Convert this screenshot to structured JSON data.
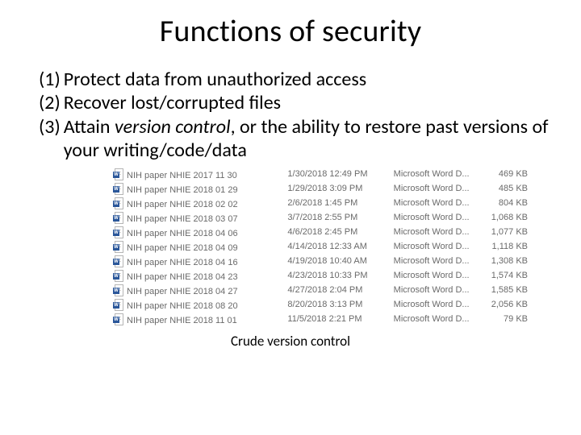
{
  "title": "Functions of security",
  "bullets": [
    {
      "num": "(1)",
      "text": "Protect data from unauthorized access"
    },
    {
      "num": "(2)",
      "text": "Recover lost/corrupted files"
    },
    {
      "num": "(3)",
      "text_pre": "Attain ",
      "vc": "version control",
      "text_post": ", or the ability to restore past versions of your writing/code/data"
    }
  ],
  "files": [
    {
      "name": "NIH paper NHIE 2017 11 30",
      "date": "1/30/2018 12:49 PM",
      "type": "Microsoft Word D...",
      "size": "469 KB"
    },
    {
      "name": "NIH paper NHIE 2018 01 29",
      "date": "1/29/2018 3:09 PM",
      "type": "Microsoft Word D...",
      "size": "485 KB"
    },
    {
      "name": "NIH paper NHIE 2018 02 02",
      "date": "2/6/2018 1:45 PM",
      "type": "Microsoft Word D...",
      "size": "804 KB"
    },
    {
      "name": "NIH paper NHIE 2018 03 07",
      "date": "3/7/2018 2:55 PM",
      "type": "Microsoft Word D...",
      "size": "1,068 KB"
    },
    {
      "name": "NIH paper NHIE 2018 04 06",
      "date": "4/6/2018 2:45 PM",
      "type": "Microsoft Word D...",
      "size": "1,077 KB"
    },
    {
      "name": "NIH paper NHIE 2018 04 09",
      "date": "4/14/2018 12:33 AM",
      "type": "Microsoft Word D...",
      "size": "1,118 KB"
    },
    {
      "name": "NIH paper NHIE 2018 04 16",
      "date": "4/19/2018 10:40 AM",
      "type": "Microsoft Word D...",
      "size": "1,308 KB"
    },
    {
      "name": "NIH paper NHIE 2018 04 23",
      "date": "4/23/2018 10:33 PM",
      "type": "Microsoft Word D...",
      "size": "1,574 KB"
    },
    {
      "name": "NIH paper NHIE 2018 04 27",
      "date": "4/27/2018 2:04 PM",
      "type": "Microsoft Word D...",
      "size": "1,585 KB"
    },
    {
      "name": "NIH paper NHIE 2018 08 20",
      "date": "8/20/2018 3:13 PM",
      "type": "Microsoft Word D...",
      "size": "2,056 KB"
    },
    {
      "name": "NIH paper NHIE 2018 11 01",
      "date": "11/5/2018 2:21 PM",
      "type": "Microsoft Word D...",
      "size": "79 KB"
    }
  ],
  "caption": "Crude version control"
}
